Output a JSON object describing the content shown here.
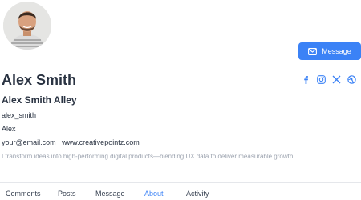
{
  "profile": {
    "name": "Alex Smith",
    "display_name": "Alex Smith Alley",
    "username": "alex_smith",
    "first_name": "Alex",
    "email": "your@email.com",
    "website": "www.creativepointz.com",
    "bio": "I transform ideas into high-performing digital products—blending UX data to deliver measurable growth"
  },
  "actions": {
    "message_label": "Message"
  },
  "socials": [
    "facebook-icon",
    "instagram-icon",
    "x-icon",
    "dribbble-icon"
  ],
  "tabs": [
    {
      "label": "Comments",
      "active": false
    },
    {
      "label": "Posts",
      "active": false
    },
    {
      "label": "Message",
      "active": false
    },
    {
      "label": "About",
      "active": true
    },
    {
      "label": "Activity",
      "active": false
    }
  ],
  "colors": {
    "accent": "#3b82f6",
    "text": "#2a3342",
    "muted": "#9ca3af"
  }
}
